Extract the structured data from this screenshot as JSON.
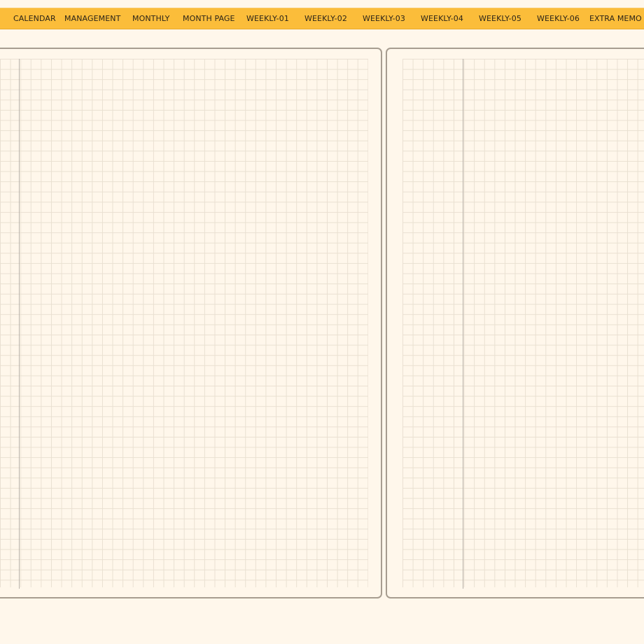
{
  "tabs": [
    {
      "label": "CALENDAR"
    },
    {
      "label": "MANAGEMENT"
    },
    {
      "label": "MONTHLY"
    },
    {
      "label": "MONTH PAGE"
    },
    {
      "label": "WEEKLY-01"
    },
    {
      "label": "WEEKLY-02"
    },
    {
      "label": "WEEKLY-03"
    },
    {
      "label": "WEEKLY-04"
    },
    {
      "label": "WEEKLY-05"
    },
    {
      "label": "WEEKLY-06"
    },
    {
      "label": "EXTRA MEMO"
    }
  ],
  "colors": {
    "tab_bar": "#fbbd3a",
    "page_background": "#fff7eb",
    "page_border": "#a79d90",
    "grid_line": "#e9e0d1"
  }
}
